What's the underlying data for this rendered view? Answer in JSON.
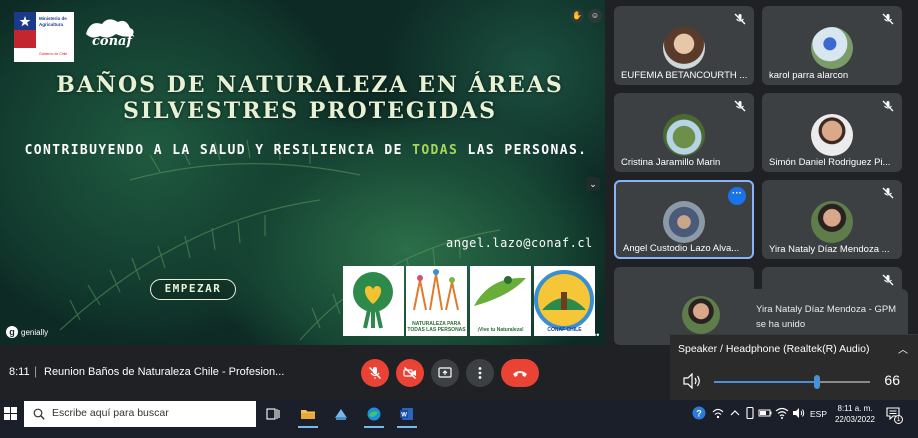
{
  "presentation": {
    "title_line1": "BAÑOS DE NATURALEZA EN ÁREAS",
    "title_line2": "SILVESTRES PROTEGIDAS",
    "subtitle_a": "CONTRIBUYENDO A LA SALUD Y RESILIENCIA DE ",
    "subtitle_highlight": "TODAS",
    "subtitle_b": " LAS PERSONAS.",
    "email": "angel.lazo@conaf.cl",
    "start_button": "EMPEZAR",
    "gov_logo_text": "Ministerio de Agricultura",
    "gov_logo_sub": "Gobierno de Chile",
    "conaf_logo": "conaf",
    "genially_label": "genially",
    "logo_captions": [
      "",
      "NATURALEZA PARA TODAS LAS PERSONAS",
      "¡Vive tu Naturaleza!",
      "CONAF CHILE"
    ],
    "accent_color": "#a9d65a"
  },
  "participants": [
    {
      "name": "EUFEMIA BETANCOURTH ...",
      "muted": true
    },
    {
      "name": "karol parra alarcon",
      "muted": true
    },
    {
      "name": "Cristina Jaramillo Marin",
      "muted": true
    },
    {
      "name": "Simón Daniel Rodriguez Pi...",
      "muted": true
    },
    {
      "name": "Angel Custodio Lazo Alva...",
      "muted": false,
      "active": true
    },
    {
      "name": "Yira Nataly Díaz Mendoza ...",
      "muted": true
    }
  ],
  "toast": {
    "text": "Yira Nataly Díaz Mendoza - GPM se ha unido"
  },
  "audio": {
    "device": "Speaker / Headphone (Realtek(R) Audio)",
    "level": 66
  },
  "meeting": {
    "time": "8:11",
    "separator": "|",
    "title": "Reunion Baños de Naturaleza Chile - Profesion..."
  },
  "taskbar": {
    "search_placeholder": "Escribe aquí para buscar",
    "language": "ESP",
    "clock_time": "8:11 a. m.",
    "clock_date": "22/03/2022",
    "notification_count": "1"
  },
  "colors": {
    "meet_red": "#ea4335",
    "meet_tile": "#3c4043",
    "active_border": "#8ab4f8",
    "volume_accent": "#4a90d9"
  }
}
